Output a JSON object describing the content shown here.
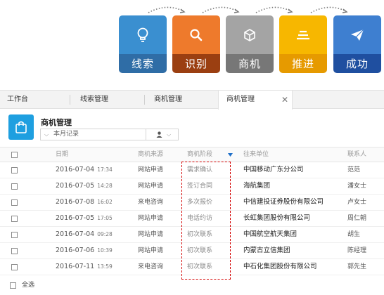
{
  "stages": [
    {
      "label": "线索",
      "icon": "lightbulb-icon",
      "top_color": "#3a8fd0",
      "bottom_color": "#2f6da6"
    },
    {
      "label": "识别",
      "icon": "search-icon",
      "top_color": "#ee7a2c",
      "bottom_color": "#9b3f11"
    },
    {
      "label": "商机",
      "icon": "cube-icon",
      "top_color": "#a4a4a4",
      "bottom_color": "#777777"
    },
    {
      "label": "推进",
      "icon": "layers-icon",
      "top_color": "#f7b700",
      "bottom_color": "#e69a00"
    },
    {
      "label": "成功",
      "icon": "paper-plane-icon",
      "top_color": "#3e7fd0",
      "bottom_color": "#1f4fa0"
    }
  ],
  "tabs": [
    "工作台",
    "线索管理",
    "商机管理",
    "商机管理"
  ],
  "tab_close": "✕",
  "page": {
    "title": "商机管理",
    "filter": "本月记录"
  },
  "columns": {
    "date": "日期",
    "source": "商机来源",
    "stage": "商机阶段",
    "company": "往来单位",
    "contact": "联系人"
  },
  "rows": [
    {
      "date": "2016-07-04",
      "time": "17:34",
      "source": "网站申请",
      "stage": "需求确认",
      "company": "中国移动广东分公司",
      "contact": "范范"
    },
    {
      "date": "2016-07-05",
      "time": "14:28",
      "source": "网站申请",
      "stage": "签订合同",
      "company": "海航集团",
      "contact": "潘女士"
    },
    {
      "date": "2016-07-08",
      "time": "16:02",
      "source": "来电咨询",
      "stage": "多次报价",
      "company": "中信建投证券股份有限公司",
      "contact": "卢女士"
    },
    {
      "date": "2016-07-05",
      "time": "17:05",
      "source": "网站申请",
      "stage": "电话约访",
      "company": "长虹集团股份有限公司",
      "contact": "周仁朝"
    },
    {
      "date": "2016-07-04",
      "time": "09:28",
      "source": "网站申请",
      "stage": "初次联系",
      "company": "中国航空航天集团",
      "contact": "胡生"
    },
    {
      "date": "2016-07-06",
      "time": "10:39",
      "source": "网站申请",
      "stage": "初次联系",
      "company": "内蒙古立信集团",
      "contact": "陈经理"
    },
    {
      "date": "2016-07-11",
      "time": "13:59",
      "source": "来电咨询",
      "stage": "初次联系",
      "company": "中石化集团股份有限公司",
      "contact": "郭先生"
    }
  ],
  "footer": {
    "select_all": "全选"
  },
  "colors": {
    "accent": "#1e9fe0",
    "highlight": "#d40000",
    "sort_arrow": "#1e6fc8"
  }
}
